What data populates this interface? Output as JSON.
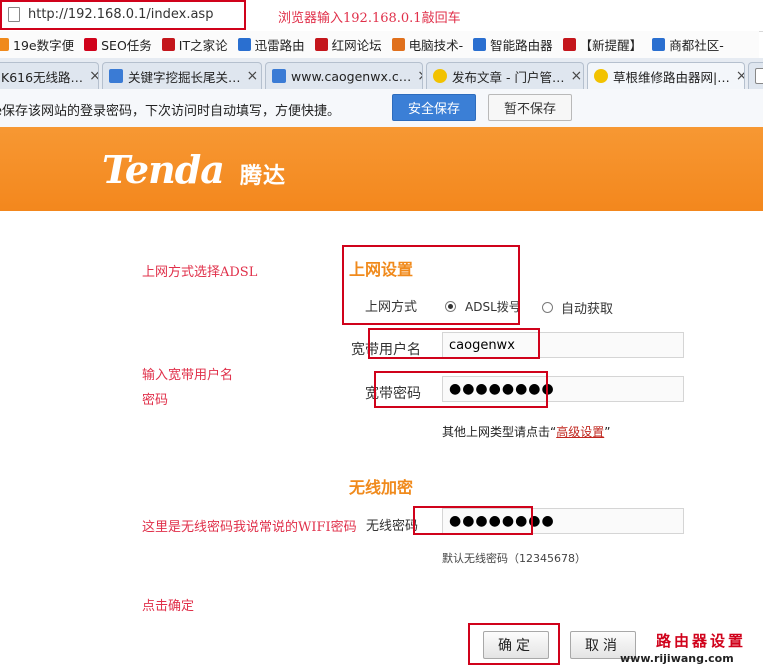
{
  "browser": {
    "url": "http://192.168.0.1/index.asp",
    "url_note": "浏览器输入192.168.0.1敲回车",
    "bookmarks": [
      {
        "label": "19e数字便",
        "icon": "19e-icon",
        "color": "#f08a1c"
      },
      {
        "label": "SEO任务",
        "icon": "seo-icon",
        "color": "#d0021b"
      },
      {
        "label": "IT之家论",
        "icon": "it-icon",
        "color": "#c4161c"
      },
      {
        "label": "迅雷路由",
        "icon": "thunder-icon",
        "color": "#2a6fd0"
      },
      {
        "label": "红网论坛",
        "icon": "redweb-icon",
        "color": "#c4161c"
      },
      {
        "label": "电脑技术-",
        "icon": "pc-icon",
        "color": "#e0701c"
      },
      {
        "label": "智能路由器",
        "icon": "router-icon",
        "color": "#2a6fd0"
      },
      {
        "label": "【新提醒】",
        "icon": "bell-icon",
        "color": "#c4161c"
      },
      {
        "label": "商都社区-",
        "icon": "shangdu-icon",
        "color": "#2a6fd0"
      }
    ],
    "tabs": [
      {
        "label": "K616无线路…"
      },
      {
        "label": "关键字挖掘长尾关…"
      },
      {
        "label": "www.caogenwx.c…"
      },
      {
        "label": "发布文章 - 门户管…"
      },
      {
        "label": "草根维修路由器网|…"
      }
    ],
    "password_bar": {
      "message": "e保存该网站的登录密码，下次访问时自动填写，方便快捷。",
      "save_label": "安全保存",
      "nosave_label": "暂不保存"
    }
  },
  "header": {
    "logo_text": "Tenda",
    "logo_cn": "腾达"
  },
  "annotations": {
    "step1": "上网方式选择ADSL",
    "step2_line1": "输入宽带用户名",
    "step2_line2": "密码",
    "step3": "这里是无线密码我说常说的WIFI密码",
    "step4": "点击确定"
  },
  "internet": {
    "section_title": "上网设置",
    "mode_label": "上网方式",
    "option_adsl": "ADSL拨号",
    "option_auto": "自动获取",
    "username_label": "宽带用户名",
    "username_value": "caogenwx",
    "password_label": "宽带密码",
    "password_value": "●●●●●●●●",
    "advanced_prefix": "其他上网类型请点击“",
    "advanced_link": "高级设置",
    "advanced_suffix": "”"
  },
  "wireless": {
    "section_title": "无线加密",
    "password_label": "无线密码",
    "password_value": "●●●●●●●●",
    "default_note": "默认无线密码（12345678）"
  },
  "actions": {
    "ok": "确定",
    "cancel": "取消"
  },
  "watermark": {
    "title": "路由器设置",
    "domain": "www.rijiwang.com"
  }
}
